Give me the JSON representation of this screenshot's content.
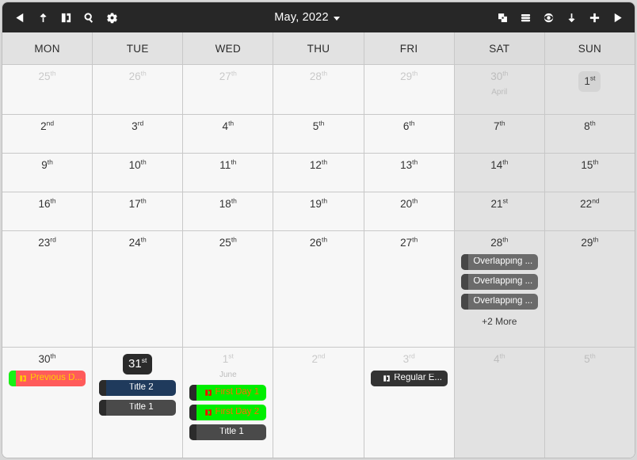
{
  "toolbar": {
    "left_buttons": [
      {
        "name": "previous-icon",
        "label": "Previous"
      },
      {
        "name": "up-arrow-icon",
        "label": "Up"
      },
      {
        "name": "calendar-page-icon",
        "label": "Calendar"
      },
      {
        "name": "search-icon",
        "label": "Search"
      },
      {
        "name": "gear-icon",
        "label": "Settings"
      }
    ],
    "title": "May, 2022",
    "right_buttons": [
      {
        "name": "copy-icon",
        "label": "Copy"
      },
      {
        "name": "menu-icon",
        "label": "Menu"
      },
      {
        "name": "eye-icon",
        "label": "View"
      },
      {
        "name": "download-icon",
        "label": "Download"
      },
      {
        "name": "add-icon",
        "label": "Add"
      },
      {
        "name": "next-icon",
        "label": "Next"
      }
    ]
  },
  "weekdays": [
    {
      "label": "MON",
      "weekend": false
    },
    {
      "label": "TUE",
      "weekend": false
    },
    {
      "label": "WED",
      "weekend": false
    },
    {
      "label": "THU",
      "weekend": false
    },
    {
      "label": "FRI",
      "weekend": false
    },
    {
      "label": "SAT",
      "weekend": true
    },
    {
      "label": "SUN",
      "weekend": true
    }
  ],
  "colors": {
    "toolbar_bg": "#272727",
    "weekday_bg": "#f7f7f7",
    "weekend_bg": "#e2e2e2",
    "header_bg": "#e2e2e2",
    "grid_line": "#c8c8c8",
    "today_badge": "#2b2b2b",
    "selected_badge": "#d4d4d4",
    "event_gray": "#6b6b6b",
    "event_navy": "#1f3a5c",
    "event_dark": "#4a4a4a",
    "event_black": "#333333",
    "event_red": "#ff5b5b",
    "event_green": "#00ee00"
  },
  "more_label": "+2 More",
  "weeks": [
    {
      "height_class": "w0",
      "days": [
        {
          "num": "25",
          "ord": "th",
          "other": true,
          "weekend": false,
          "events": []
        },
        {
          "num": "26",
          "ord": "th",
          "other": true,
          "weekend": false,
          "events": []
        },
        {
          "num": "27",
          "ord": "th",
          "other": true,
          "weekend": false,
          "events": []
        },
        {
          "num": "28",
          "ord": "th",
          "other": true,
          "weekend": false,
          "events": []
        },
        {
          "num": "29",
          "ord": "th",
          "other": true,
          "weekend": false,
          "events": []
        },
        {
          "num": "30",
          "ord": "th",
          "other": true,
          "weekend": true,
          "month_label": "April",
          "events": []
        },
        {
          "num": "1",
          "ord": "st",
          "other": false,
          "weekend": true,
          "selected": true,
          "events": []
        }
      ]
    },
    {
      "height_class": "w1",
      "days": [
        {
          "num": "2",
          "ord": "nd",
          "other": false,
          "weekend": false,
          "events": []
        },
        {
          "num": "3",
          "ord": "rd",
          "other": false,
          "weekend": false,
          "events": []
        },
        {
          "num": "4",
          "ord": "th",
          "other": false,
          "weekend": false,
          "events": []
        },
        {
          "num": "5",
          "ord": "th",
          "other": false,
          "weekend": false,
          "events": []
        },
        {
          "num": "6",
          "ord": "th",
          "other": false,
          "weekend": false,
          "events": []
        },
        {
          "num": "7",
          "ord": "th",
          "other": false,
          "weekend": true,
          "events": []
        },
        {
          "num": "8",
          "ord": "th",
          "other": false,
          "weekend": true,
          "events": []
        }
      ]
    },
    {
      "height_class": "w2",
      "days": [
        {
          "num": "9",
          "ord": "th",
          "other": false,
          "weekend": false,
          "events": []
        },
        {
          "num": "10",
          "ord": "th",
          "other": false,
          "weekend": false,
          "events": []
        },
        {
          "num": "11",
          "ord": "th",
          "other": false,
          "weekend": false,
          "events": []
        },
        {
          "num": "12",
          "ord": "th",
          "other": false,
          "weekend": false,
          "events": []
        },
        {
          "num": "13",
          "ord": "th",
          "other": false,
          "weekend": false,
          "events": []
        },
        {
          "num": "14",
          "ord": "th",
          "other": false,
          "weekend": true,
          "events": []
        },
        {
          "num": "15",
          "ord": "th",
          "other": false,
          "weekend": true,
          "events": []
        }
      ]
    },
    {
      "height_class": "w3",
      "days": [
        {
          "num": "16",
          "ord": "th",
          "other": false,
          "weekend": false,
          "events": []
        },
        {
          "num": "17",
          "ord": "th",
          "other": false,
          "weekend": false,
          "events": []
        },
        {
          "num": "18",
          "ord": "th",
          "other": false,
          "weekend": false,
          "events": []
        },
        {
          "num": "19",
          "ord": "th",
          "other": false,
          "weekend": false,
          "events": []
        },
        {
          "num": "20",
          "ord": "th",
          "other": false,
          "weekend": false,
          "events": []
        },
        {
          "num": "21",
          "ord": "st",
          "other": false,
          "weekend": true,
          "events": []
        },
        {
          "num": "22",
          "ord": "nd",
          "other": false,
          "weekend": true,
          "events": []
        }
      ]
    },
    {
      "height_class": "w4",
      "days": [
        {
          "num": "23",
          "ord": "rd",
          "other": false,
          "weekend": false,
          "events": []
        },
        {
          "num": "24",
          "ord": "th",
          "other": false,
          "weekend": false,
          "events": []
        },
        {
          "num": "25",
          "ord": "th",
          "other": false,
          "weekend": false,
          "events": []
        },
        {
          "num": "26",
          "ord": "th",
          "other": false,
          "weekend": false,
          "events": []
        },
        {
          "num": "27",
          "ord": "th",
          "other": false,
          "weekend": false,
          "events": []
        },
        {
          "num": "28",
          "ord": "th",
          "other": false,
          "weekend": true,
          "events": [
            {
              "title": "Overlapping ...",
              "bg": "#6b6b6b",
              "bar": "#474747",
              "text": "#ffffff",
              "icon": false
            },
            {
              "title": "Overlapping ...",
              "bg": "#6b6b6b",
              "bar": "#474747",
              "text": "#ffffff",
              "icon": false
            },
            {
              "title": "Overlapping ...",
              "bg": "#6b6b6b",
              "bar": "#474747",
              "text": "#ffffff",
              "icon": false
            }
          ],
          "more": "+2 More"
        },
        {
          "num": "29",
          "ord": "th",
          "other": false,
          "weekend": true,
          "events": []
        }
      ]
    },
    {
      "height_class": "w5",
      "days": [
        {
          "num": "30",
          "ord": "th",
          "other": false,
          "weekend": false,
          "events": [
            {
              "title": "Previous D...",
              "bg": "#ff5b5b",
              "bar": "#16f216",
              "text": "#ffd000",
              "icon": true,
              "icon_color": "#ffd000"
            }
          ]
        },
        {
          "num": "31",
          "ord": "st",
          "other": false,
          "weekend": false,
          "today": true,
          "events": [
            {
              "title": "Title 2",
              "bg": "#1f3a5c",
              "bar": "#2b2b2b",
              "text": "#ffffff",
              "icon": false
            },
            {
              "title": "Title 1",
              "bg": "#4a4a4a",
              "bar": "#2b2b2b",
              "text": "#ffffff",
              "icon": false
            }
          ]
        },
        {
          "num": "1",
          "ord": "st",
          "other": true,
          "weekend": false,
          "month_label": "June",
          "events": [
            {
              "title": "First Day 1",
              "bg": "#00ee00",
              "bar": "#2b2b2b",
              "text": "#ff6a00",
              "icon": true,
              "icon_color": "#ff0000"
            },
            {
              "title": "First Day 2",
              "bg": "#00ee00",
              "bar": "#2b2b2b",
              "text": "#ff6a00",
              "icon": true,
              "icon_color": "#ff0000"
            },
            {
              "title": "Title 1",
              "bg": "#4a4a4a",
              "bar": "#2b2b2b",
              "text": "#ffffff",
              "icon": false
            }
          ]
        },
        {
          "num": "2",
          "ord": "nd",
          "other": true,
          "weekend": false,
          "events": []
        },
        {
          "num": "3",
          "ord": "rd",
          "other": true,
          "weekend": false,
          "events": [
            {
              "title": "Regular E...",
              "bg": "#333333",
              "bar": "#333333",
              "text": "#ffffff",
              "icon": true,
              "icon_color": "#ffffff"
            }
          ]
        },
        {
          "num": "4",
          "ord": "th",
          "other": true,
          "weekend": true,
          "events": []
        },
        {
          "num": "5",
          "ord": "th",
          "other": true,
          "weekend": true,
          "events": []
        }
      ]
    }
  ]
}
